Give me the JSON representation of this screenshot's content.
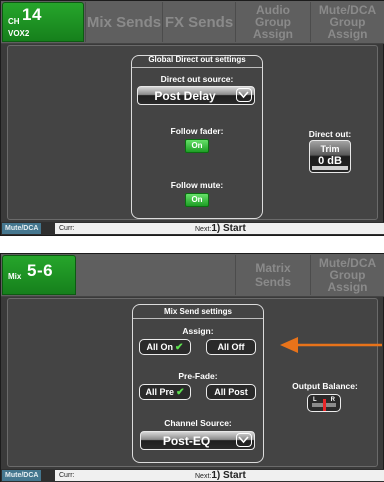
{
  "screen1": {
    "channel": {
      "prefix": "CH",
      "number": "14",
      "name": "VOX2"
    },
    "tabs": [
      {
        "label": "Mix Sends"
      },
      {
        "label": "FX Sends"
      },
      {
        "line1": "Audio",
        "line2": "Group Assign"
      },
      {
        "line1": "Mute/DCA",
        "line2": "Group Assign"
      }
    ],
    "group_title": "Global Direct out settings",
    "direct_out_source": {
      "label": "Direct out source:",
      "value": "Post Delay"
    },
    "follow_fader": {
      "label": "Follow fader:",
      "button": "On"
    },
    "follow_mute": {
      "label": "Follow mute:",
      "button": "On"
    },
    "direct_out": {
      "label": "Direct out:",
      "button_line1": "Trim",
      "button_line2": "0 dB"
    },
    "status": {
      "mute_dca": "Mute/DCA",
      "curr": "Curr:",
      "next_prefix": "Next:",
      "next_value": "1) Start"
    }
  },
  "screen2": {
    "mix": {
      "prefix": "Mix",
      "number": "5-6"
    },
    "tabs": [
      {
        "label": "Matrix Sends"
      },
      {
        "line1": "Mute/DCA",
        "line2": "Group Assign"
      }
    ],
    "group_title": "Mix Send settings",
    "assign": {
      "label": "Assign:",
      "all_on": "All On",
      "all_off": "All Off"
    },
    "pre_fade": {
      "label": "Pre-Fade:",
      "all_pre": "All Pre",
      "all_post": "All Post"
    },
    "channel_source": {
      "label": "Channel Source:",
      "value": "Post-EQ"
    },
    "output_balance": {
      "label": "Output Balance:",
      "left": "L",
      "right": "R",
      "position": 0.5
    },
    "status": {
      "mute_dca": "Mute/DCA",
      "curr": "Curr:",
      "next_prefix": "Next:",
      "next_value": "1) Start"
    }
  },
  "icons": {
    "check": "check-icon",
    "chevron": "chevron-down-icon",
    "arrow": "arrow-left-icon"
  },
  "colors": {
    "accent_green": "#1e9e25",
    "arrow_orange": "#e8731a",
    "status_blue": "#45778f"
  }
}
